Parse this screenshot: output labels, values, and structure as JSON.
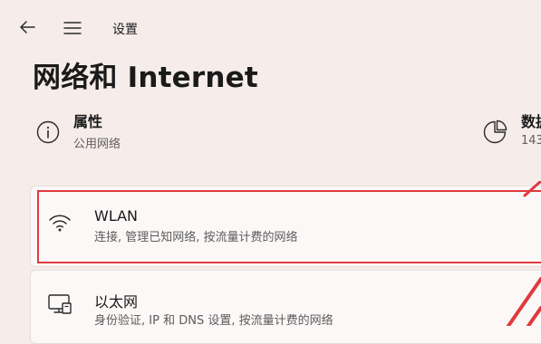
{
  "titlebar": {
    "back_icon": "back-arrow-icon",
    "menu_icon": "hamburger-menu-icon",
    "title": "设置"
  },
  "page": {
    "title": "网络和 Internet"
  },
  "summary": {
    "properties": {
      "title": "属性",
      "subtitle": "公用网络",
      "icon": "info-icon"
    },
    "data_usage": {
      "title": "数据",
      "subtitle": "143",
      "icon": "pie-chart-icon"
    }
  },
  "items": {
    "wlan": {
      "title": "WLAN",
      "subtitle": "连接, 管理已知网络, 按流量计费的网络",
      "icon": "wifi-icon"
    },
    "ethernet": {
      "title": "以太网",
      "subtitle": "身份验证, IP 和 DNS 设置, 按流量计费的网络",
      "icon": "ethernet-icon"
    }
  },
  "colors": {
    "background": "#f6ecea",
    "card": "#fbf8f7",
    "highlight": "#e03a3e"
  }
}
